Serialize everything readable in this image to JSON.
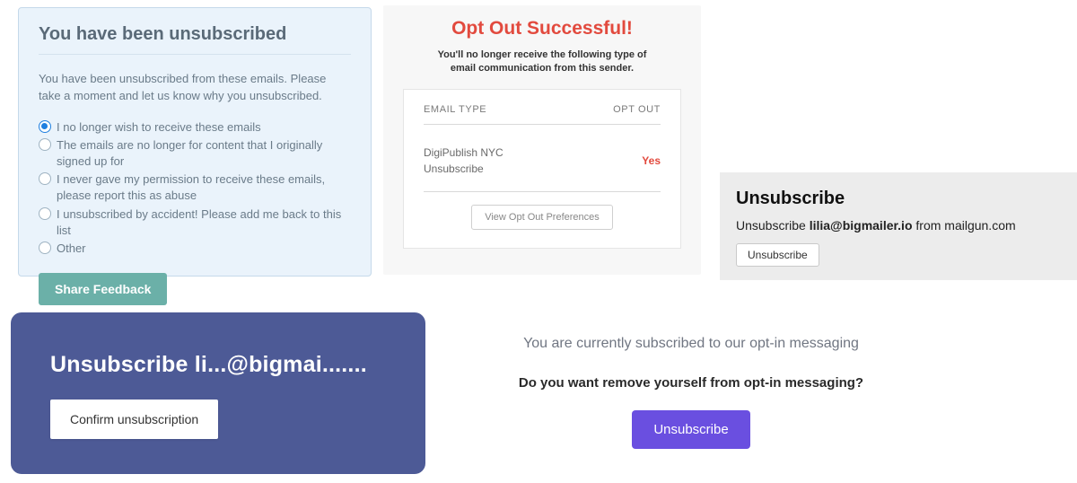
{
  "panel1": {
    "title": "You have been unsubscribed",
    "lead": "You have been unsubscribed from these emails. Please take a moment and let us know why you unsubscribed.",
    "options": [
      "I no longer wish to receive these emails",
      "The emails are no longer for content that I originally signed up for",
      "I never gave my permission to receive these emails, please report this as abuse",
      "I unsubscribed by accident! Please add me back to this list",
      "Other"
    ],
    "selected_index": 0,
    "button": "Share Feedback"
  },
  "panel2": {
    "title": "Opt Out Successful!",
    "subtitle": "You'll no longer receive the following type of email communication from this sender.",
    "col_left": "EMAIL TYPE",
    "col_right": "OPT OUT",
    "row_type_line1": "DigiPublish NYC",
    "row_type_line2": "Unsubscribe",
    "row_status": "Yes",
    "view_button": "View Opt Out Preferences"
  },
  "panel3": {
    "title": "Unsubscribe",
    "prefix": "Unsubscribe ",
    "email": "lilia@bigmailer.io",
    "suffix": " from mailgun.com",
    "button": "Unsubscribe"
  },
  "panel4": {
    "title": "Unsubscribe li...@bigmai.......",
    "button": "Confirm unsubscription"
  },
  "panel5": {
    "line1": "You are currently subscribed to our opt-in messaging",
    "line2": "Do you want remove yourself from opt-in messaging?",
    "button": "Unsubscribe"
  }
}
